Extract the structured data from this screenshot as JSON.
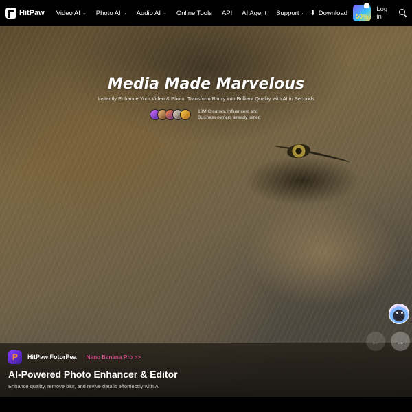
{
  "nav": {
    "brand": "HitPaw",
    "items": [
      {
        "label": "Video AI",
        "has_chevron": true
      },
      {
        "label": "Photo AI",
        "has_chevron": true
      },
      {
        "label": "Audio AI",
        "has_chevron": true
      },
      {
        "label": "Online Tools",
        "has_chevron": false
      },
      {
        "label": "API",
        "has_chevron": false
      },
      {
        "label": "AI Agent",
        "has_chevron": false
      },
      {
        "label": "Support",
        "has_chevron": true
      }
    ],
    "download_label": "Download",
    "promo_badge_text": "50%",
    "login_label": "Log in",
    "chevron_glyph": "⌄",
    "download_glyph": "⬇",
    "search_icon": "search-icon"
  },
  "hero": {
    "headline": "Media Made Marvelous",
    "subline": "Instantly Enhance Your Video & Photo: Transform Blurry into Brilliant Quality with AI in Seconds",
    "social_proof": "13M Creators, Influencers and Business owners already joined"
  },
  "panel": {
    "product_icon_letter": "P",
    "product_name": "HitPaw FotorPea",
    "product_tag": "Nano Banana Pro >>",
    "title": "AI-Powered Photo Enhancer & Editor",
    "description": "Enhance quality, remove blur, and revive details effortlessly with AI",
    "prev_arrow": "←",
    "next_arrow": "→"
  },
  "colors": {
    "nav_bg": "#000000",
    "tag_pink": "#ff4fa3",
    "accent_purple": "#8a3cff"
  }
}
